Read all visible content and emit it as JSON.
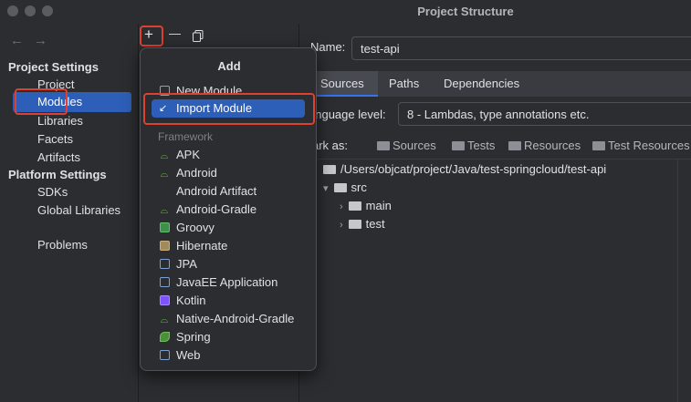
{
  "window": {
    "title": "Project Structure"
  },
  "nav": {
    "back_icon": "arrow-left-icon",
    "forward_icon": "arrow-right-icon",
    "project_settings_header": "Project Settings",
    "project_settings_items": [
      "Project",
      "Modules",
      "Libraries",
      "Facets",
      "Artifacts"
    ],
    "selected_item": "Modules",
    "platform_settings_header": "Platform Settings",
    "platform_settings_items": [
      "SDKs",
      "Global Libraries"
    ],
    "problems": "Problems"
  },
  "module_toolbar": {
    "add": "+",
    "remove": "—",
    "copy_icon": "copy-icon"
  },
  "add_popup": {
    "title": "Add",
    "new_module": "New Module",
    "import_module": "Import Module",
    "framework_header": "Framework",
    "frameworks": [
      "APK",
      "Android",
      "Android Artifact",
      "Android-Gradle",
      "Groovy",
      "Hibernate",
      "JPA",
      "JavaEE Application",
      "Kotlin",
      "Native-Android-Gradle",
      "Spring",
      "Web"
    ]
  },
  "details": {
    "name_label": "Name:",
    "name_value": "test-api",
    "tabs": [
      "Sources",
      "Paths",
      "Dependencies"
    ],
    "active_tab": "Sources",
    "language_level_label": "anguage level:",
    "language_level_value": "8 - Lambdas, type annotations etc.",
    "mark_as_label": "ark as:",
    "mark_as_buttons": [
      "Sources",
      "Tests",
      "Resources",
      "Test Resources"
    ],
    "tree": {
      "root": "/Users/objcat/project/Java/test-springcloud/test-api",
      "src": "src",
      "main": "main",
      "test": "test"
    }
  },
  "colors": {
    "accent": "#2e5fb8",
    "highlight_border": "#e0402f",
    "background": "#2b2d30"
  }
}
